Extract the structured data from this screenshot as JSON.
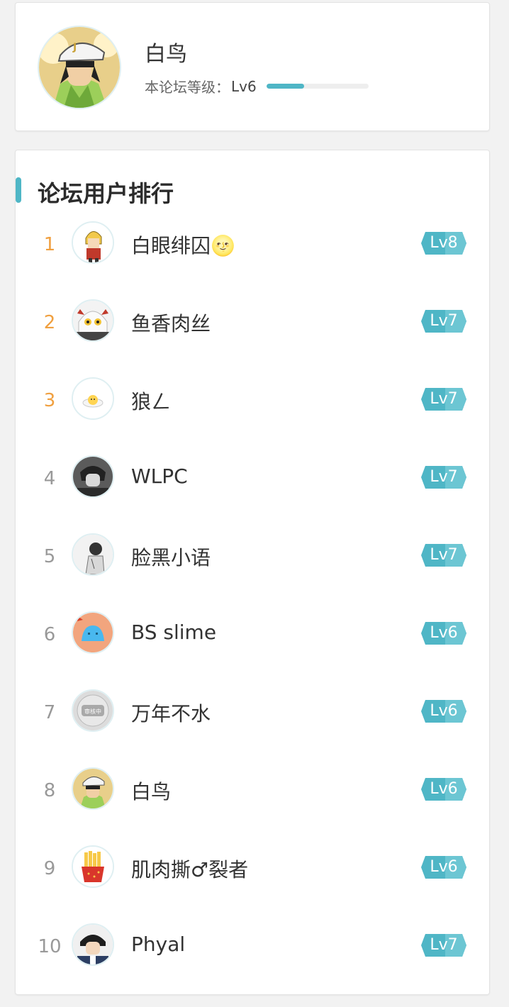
{
  "profile": {
    "name": "白鸟",
    "level_label": "本论坛等级：",
    "level": "Lv6",
    "level_progress_percent": 37
  },
  "ranking": {
    "title": "论坛用户排行",
    "rows": [
      {
        "rank": "1",
        "name": "白眼绯囚🌝",
        "level": "Lv8",
        "avatar": "blonde-boy-icon"
      },
      {
        "rank": "2",
        "name": "鱼香肉丝",
        "level": "Lv7",
        "avatar": "anime-girl-icon"
      },
      {
        "rank": "3",
        "name": "狼ㄥ",
        "level": "Lv7",
        "avatar": "egg-icon"
      },
      {
        "rank": "4",
        "name": "WLPC",
        "level": "Lv7",
        "avatar": "dark-hair-boy-icon"
      },
      {
        "rank": "5",
        "name": "脸黑小语",
        "level": "Lv7",
        "avatar": "sketch-boy-icon"
      },
      {
        "rank": "6",
        "name": "BS slime",
        "level": "Lv6",
        "avatar": "slime-icon"
      },
      {
        "rank": "7",
        "name": "万年不水",
        "level": "Lv6",
        "avatar": "under-review-icon"
      },
      {
        "rank": "8",
        "name": "白鸟",
        "level": "Lv6",
        "avatar": "jotaro-icon"
      },
      {
        "rank": "9",
        "name": "肌肉撕♂裂者",
        "level": "Lv6",
        "avatar": "fries-icon"
      },
      {
        "rank": "10",
        "name": "Phyal",
        "level": "Lv7",
        "avatar": "detective-icon"
      }
    ],
    "avatar_badge_text": "审核中"
  },
  "colors": {
    "accent": "#4fb6c6",
    "top_rank": "#f0a040",
    "rank": "#999999"
  }
}
